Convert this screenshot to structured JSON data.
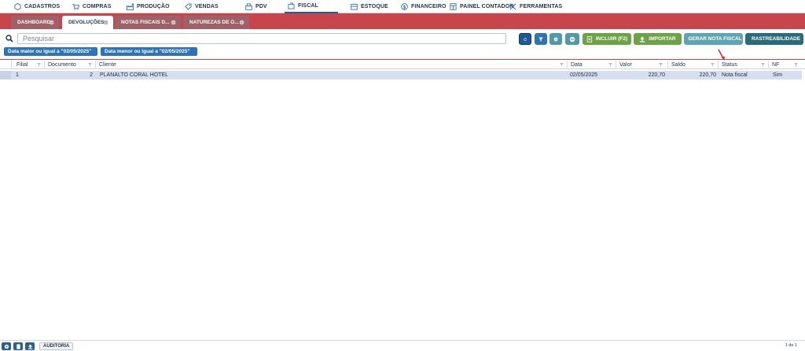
{
  "menu": [
    {
      "label": "CADASTROS",
      "icon": "hexagon-icon"
    },
    {
      "label": "COMPRAS",
      "icon": "cart-icon"
    },
    {
      "label": "PRODUÇÃO",
      "icon": "factory-icon"
    },
    {
      "label": "VENDAS",
      "icon": "tag-icon"
    },
    {
      "label": "PDV",
      "icon": "register-icon"
    },
    {
      "label": "FISCAL",
      "icon": "receipt-icon"
    },
    {
      "label": "ESTOQUE",
      "icon": "box-icon"
    },
    {
      "label": "FINANCEIRO",
      "icon": "dollar-icon"
    },
    {
      "label": "PAINEL CONTADOR",
      "icon": "calculator-icon"
    },
    {
      "label": "FERRAMENTAS",
      "icon": "tools-icon"
    }
  ],
  "tabs": [
    {
      "label": "DASHBOARD"
    },
    {
      "label": "DEVOLUÇÕES"
    },
    {
      "label": "NOTAS FISCAIS D..."
    },
    {
      "label": "NATUREZAS DE O..."
    }
  ],
  "search": {
    "placeholder": "Pesquisar"
  },
  "toolbar": {
    "include_label": "INCLUIR (F2)",
    "import_label": "IMPORTAR",
    "generate_label": "GERAR NOTA FISCAL",
    "trace_label": "RASTREABILIDADE"
  },
  "filters": [
    "Data maior ou igual a \"02/05/2025\"",
    "Data menor ou igual a \"02/05/2025\""
  ],
  "grid": {
    "columns": [
      "Filial",
      "Documento",
      "Cliente",
      "Data",
      "Valor",
      "Saldo",
      "Status",
      "NF"
    ],
    "rows": [
      {
        "filial": "1",
        "documento": "2",
        "cliente": "PLANALTO CORAL HOTEL",
        "data": "02/05/2025",
        "valor": "220,70",
        "saldo": "220,70",
        "status": "Nota fiscal",
        "nf": "Sim"
      }
    ]
  },
  "footer": {
    "audit_label": "AUDITORIA",
    "pager": "1 de 1"
  },
  "colors": {
    "accent_red": "#c9454c",
    "primary_blue": "#2e74b5",
    "green": "#6ba346",
    "teal": "#4e9aa8",
    "dark_teal": "#2a6b7a"
  }
}
